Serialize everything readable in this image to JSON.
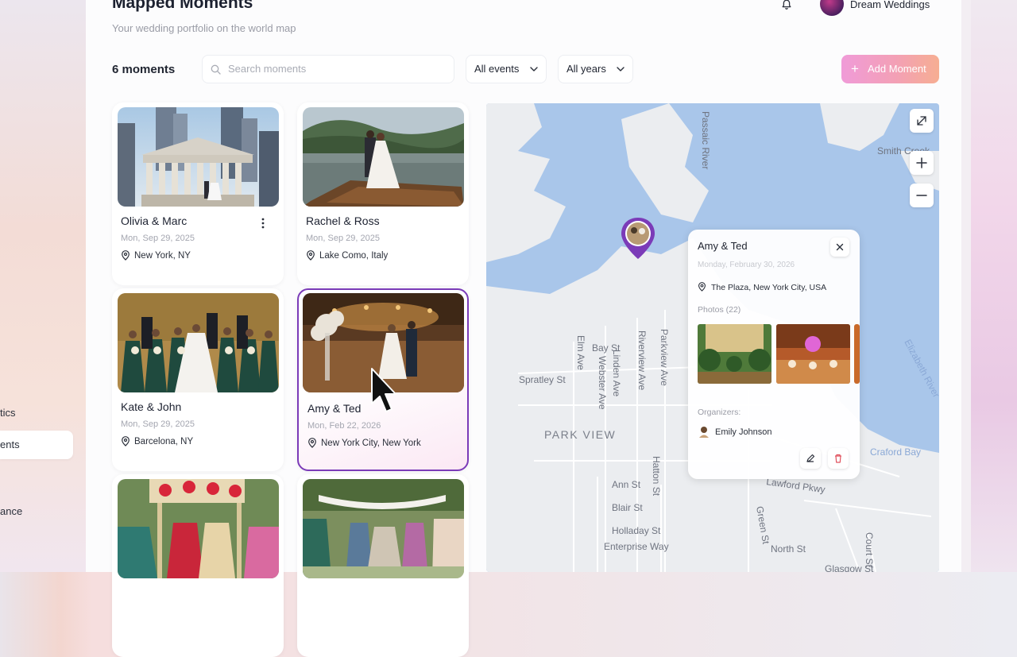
{
  "sidebar": {
    "items": [
      {
        "label": "tics"
      },
      {
        "label": "ents"
      },
      {
        "label": "ance"
      }
    ]
  },
  "header": {
    "title": "Mapped Moments",
    "subtitle": "Your wedding portfolio on the world map",
    "user_name": "Dream Weddings"
  },
  "toolbar": {
    "count": "6 moments",
    "search_placeholder": "Search moments",
    "events_filter": "All events",
    "years_filter": "All years",
    "add_label": "Add Moment"
  },
  "moments": [
    {
      "name": "Olivia & Marc",
      "date": "Mon, Sep 29, 2025",
      "location": "New York, NY"
    },
    {
      "name": "Rachel & Ross",
      "date": "Mon, Sep 29, 2025",
      "location": "Lake Como, Italy"
    },
    {
      "name": "Kate & John",
      "date": "Mon, Sep 29, 2025",
      "location": "Barcelona, NY"
    },
    {
      "name": "Amy & Ted",
      "date": "Mon, Feb 22, 2026",
      "location": "New York City, New York"
    }
  ],
  "map": {
    "labels": {
      "river1": "Passaic River",
      "river2": "Smith Creek",
      "river3": "Elizabeth River",
      "crafo": "Craford Bay",
      "spratley": "Spratley St",
      "elm": "Elm Ave",
      "bay": "Bay St",
      "linden": "Linden Ave",
      "webster": "Webster Ave",
      "riverview": "Riverview Ave",
      "parkview": "Parkview Ave",
      "park_view": "PARK VIEW",
      "hatton": "Hatton St",
      "ann": "Ann St",
      "blair": "Blair St",
      "holladay": "Holladay St",
      "enterprise": "Enterprise Way",
      "green": "Green St",
      "north": "North St",
      "court": "Court St",
      "lawford": "Lawford Pkwy",
      "glasgow": "Glasgow St"
    }
  },
  "popup": {
    "title": "Amy & Ted",
    "date": "Monday, February 30, 2026",
    "location": "The Plaza, New York City, USA",
    "photos_label": "Photos (22)",
    "organizers_label": "Organizers:",
    "organizer": "Emily Johnson"
  }
}
